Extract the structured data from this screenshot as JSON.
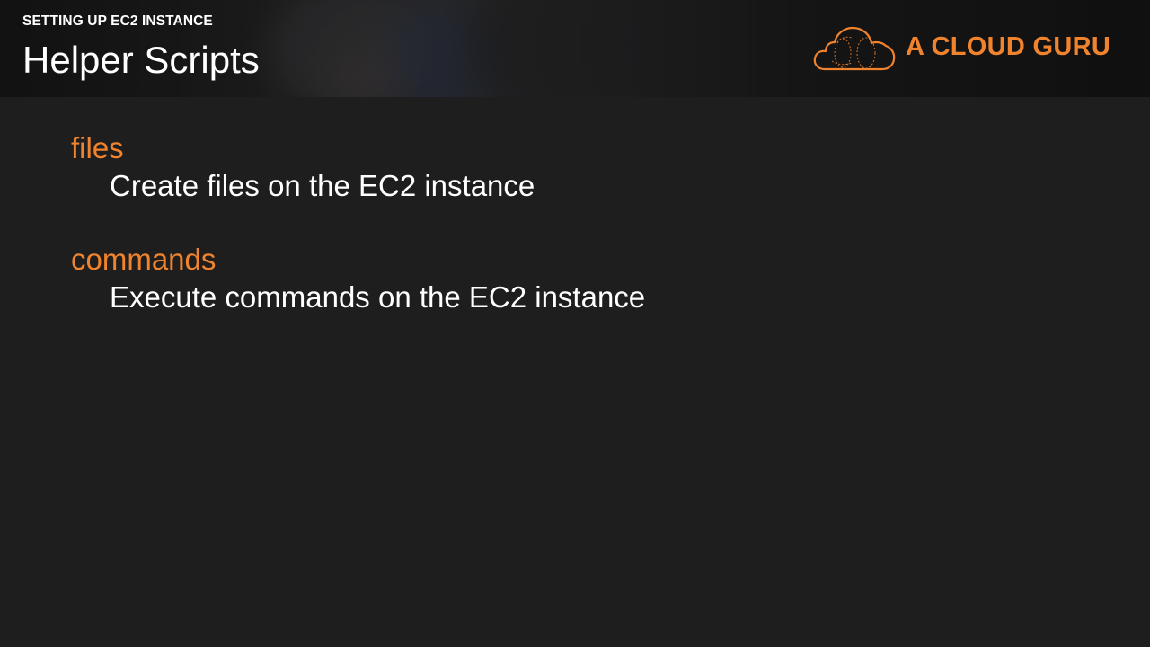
{
  "header": {
    "section_label": "SETTING UP EC2 INSTANCE",
    "title": "Helper Scripts"
  },
  "logo": {
    "icon": "cloud-logo-icon",
    "text": "A CLOUD GURU",
    "color": "#f0832d"
  },
  "items": [
    {
      "term": "files",
      "description": "Create files on the EC2 instance"
    },
    {
      "term": "commands",
      "description": "Execute commands on the EC2 instance"
    }
  ],
  "colors": {
    "accent": "#f0832d",
    "background": "#1e1e1e",
    "text": "#ffffff"
  }
}
